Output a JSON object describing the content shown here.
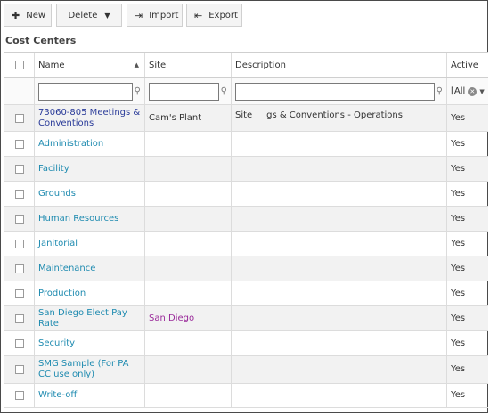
{
  "toolbar": {
    "new_label": "New",
    "delete_label": "Delete",
    "import_label": "Import",
    "export_label": "Export"
  },
  "title": "Cost Centers",
  "columns": {
    "name": "Name",
    "site": "Site",
    "description": "Description",
    "active": "Active"
  },
  "filter": {
    "active_value": "[All"
  },
  "rows": [
    {
      "name": "73060-805 Meetings & Conventions",
      "site": "Cam's Plant",
      "description": "Site     gs & Conventions - Operations",
      "active": "Yes"
    },
    {
      "name": "Administration",
      "site": "",
      "description": "",
      "active": "Yes"
    },
    {
      "name": "Facility",
      "site": "",
      "description": "",
      "active": "Yes"
    },
    {
      "name": "Grounds",
      "site": "",
      "description": "",
      "active": "Yes"
    },
    {
      "name": "Human Resources",
      "site": "",
      "description": "",
      "active": "Yes"
    },
    {
      "name": "Janitorial",
      "site": "",
      "description": "",
      "active": "Yes"
    },
    {
      "name": "Maintenance",
      "site": "",
      "description": "",
      "active": "Yes"
    },
    {
      "name": "Production",
      "site": "",
      "description": "",
      "active": "Yes"
    },
    {
      "name": "San Diego Elect Pay Rate",
      "site": "San Diego",
      "description": "",
      "active": "Yes"
    },
    {
      "name": "Security",
      "site": "",
      "description": "",
      "active": "Yes"
    },
    {
      "name": "SMG Sample (For PA CC use only)",
      "site": "",
      "description": "",
      "active": "Yes"
    },
    {
      "name": "Write-off",
      "site": "",
      "description": "",
      "active": "Yes"
    }
  ],
  "colors": {
    "link": "#1f8bb0",
    "link_dark": "#2a3b99",
    "site_link": "#9a2a9a",
    "row_shade": "#f2f2f2"
  }
}
